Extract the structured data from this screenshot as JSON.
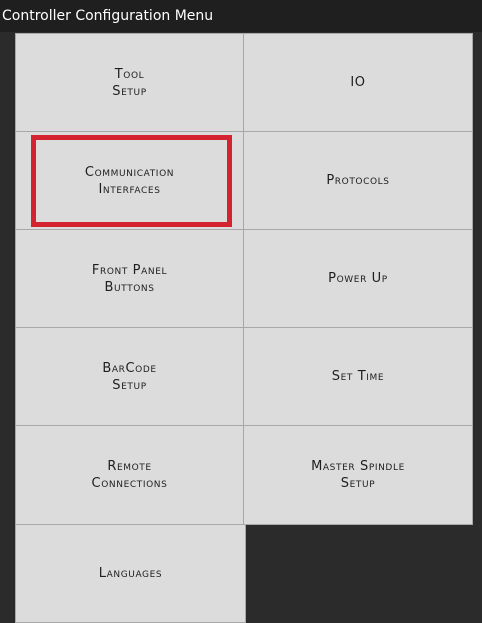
{
  "window": {
    "title": "Controller Configuration Menu"
  },
  "menu": {
    "buttons": [
      {
        "id": "tool-setup",
        "label": "Tool\nSetup"
      },
      {
        "id": "io",
        "label": "IO"
      },
      {
        "id": "communication-interfaces",
        "label": "Communication\nInterfaces",
        "highlighted": true
      },
      {
        "id": "protocols",
        "label": "Protocols"
      },
      {
        "id": "front-panel-buttons",
        "label": "Front Panel\nButtons"
      },
      {
        "id": "power-up",
        "label": "Power Up"
      },
      {
        "id": "barcode-setup",
        "label": "BarCode\nSetup"
      },
      {
        "id": "set-time",
        "label": "Set Time"
      },
      {
        "id": "remote-connections",
        "label": "Remote\nConnections"
      },
      {
        "id": "master-spindle-setup",
        "label": "Master Spindle\nSetup"
      },
      {
        "id": "languages",
        "label": "Languages"
      }
    ]
  },
  "colors": {
    "highlight": "#d4222e",
    "button_bg": "#dcdcdc",
    "window_bg": "#2b2b2b"
  }
}
